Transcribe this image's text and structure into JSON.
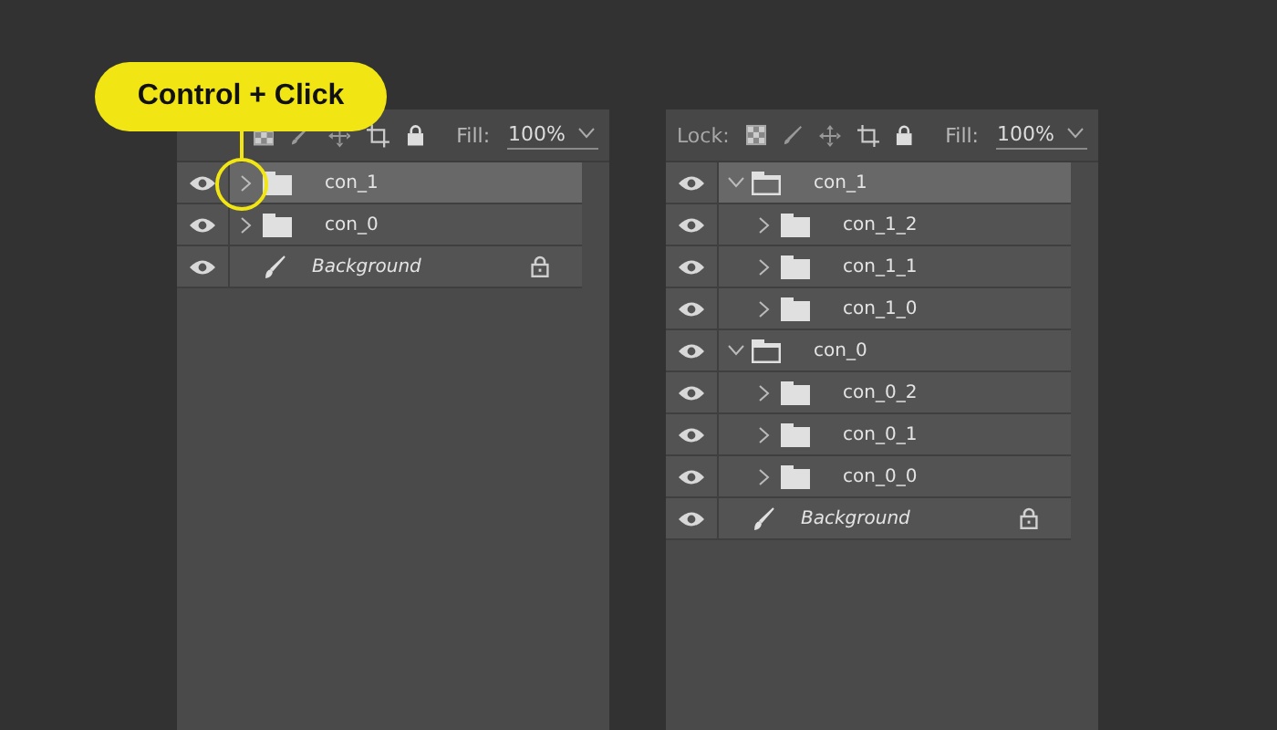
{
  "callout": {
    "text": "Control + Click"
  },
  "panels": [
    {
      "fill_label": "Fill:",
      "fill_value": "100%",
      "layers": [
        {
          "kind": "group",
          "name": "con_1",
          "expanded": false,
          "selected": true
        },
        {
          "kind": "group",
          "name": "con_0",
          "expanded": false,
          "selected": false
        },
        {
          "kind": "layer",
          "name": "Background",
          "locked": true,
          "selected": false
        }
      ]
    },
    {
      "lock_label": "Lock:",
      "fill_label": "Fill:",
      "fill_value": "100%",
      "layers": [
        {
          "kind": "group",
          "name": "con_1",
          "expanded": true,
          "selected": true,
          "children": [
            {
              "kind": "group",
              "name": "con_1_2",
              "expanded": false,
              "selected": false
            },
            {
              "kind": "group",
              "name": "con_1_1",
              "expanded": false,
              "selected": false
            },
            {
              "kind": "group",
              "name": "con_1_0",
              "expanded": false,
              "selected": false
            }
          ]
        },
        {
          "kind": "group",
          "name": "con_0",
          "expanded": true,
          "selected": false,
          "children": [
            {
              "kind": "group",
              "name": "con_0_2",
              "expanded": false,
              "selected": false
            },
            {
              "kind": "group",
              "name": "con_0_1",
              "expanded": false,
              "selected": false
            },
            {
              "kind": "group",
              "name": "con_0_0",
              "expanded": false,
              "selected": false
            }
          ]
        },
        {
          "kind": "layer",
          "name": "Background",
          "locked": true,
          "selected": false
        }
      ]
    }
  ]
}
